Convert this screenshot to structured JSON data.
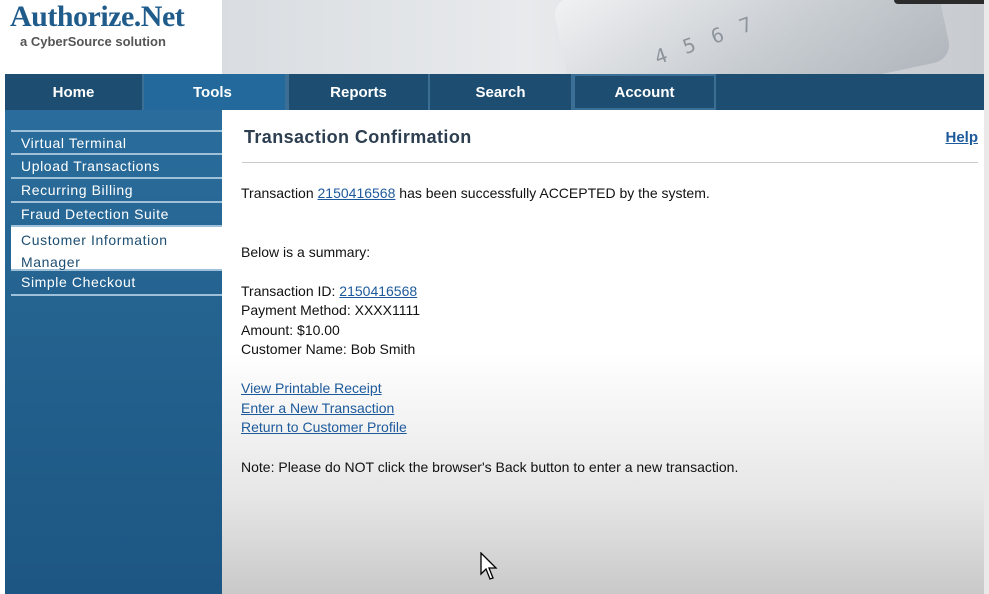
{
  "logo": {
    "title": "Authorize.Net",
    "subtitle": "a CyberSource solution"
  },
  "nav": {
    "tabs": [
      {
        "label": "Home"
      },
      {
        "label": "Tools",
        "active": true
      },
      {
        "label": "Reports"
      },
      {
        "label": "Search"
      },
      {
        "label": "Account"
      }
    ]
  },
  "sidebar": {
    "items": [
      {
        "label": "Virtual Terminal"
      },
      {
        "label": "Upload Transactions"
      },
      {
        "label": "Recurring Billing"
      },
      {
        "label": "Fraud Detection Suite"
      },
      {
        "label": "Customer Information Manager",
        "selected": true
      },
      {
        "label": "Simple Checkout"
      }
    ]
  },
  "main": {
    "title": "Transaction Confirmation",
    "help_label": "Help",
    "result": {
      "prefix": "Transaction",
      "transaction_id": "2150416568",
      "suffix": "has been successfully ACCEPTED by the system."
    },
    "summary_intro": "Below is a summary:",
    "summary": {
      "transaction_id_label": "Transaction ID:",
      "transaction_id": "2150416568",
      "payment_method": "Payment Method: XXXX1111",
      "amount": "Amount: $10.00",
      "customer_name": "Customer Name: Bob Smith"
    },
    "links": {
      "printable_receipt": "View Printable Receipt",
      "new_transaction": "Enter a New Transaction",
      "return_profile": "Return to Customer Profile"
    },
    "note": "Note: Please do NOT click the browser's Back button to enter a new transaction."
  },
  "colors": {
    "nav_bg": "#1d4e72",
    "sidebar_bg": "#24628f",
    "link": "#1d5a9c"
  }
}
